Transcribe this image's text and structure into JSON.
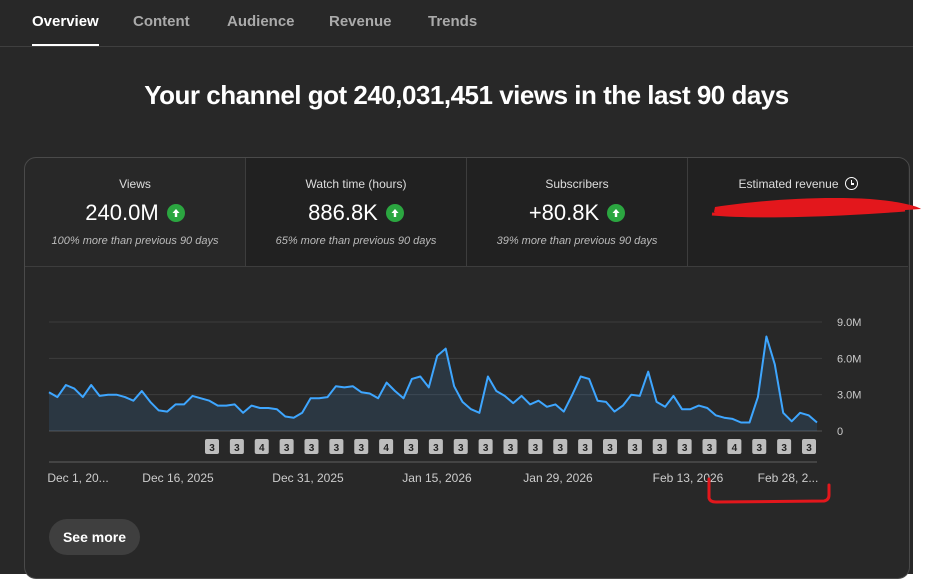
{
  "tabs": [
    {
      "label": "Overview",
      "active": true
    },
    {
      "label": "Content",
      "active": false
    },
    {
      "label": "Audience",
      "active": false
    },
    {
      "label": "Revenue",
      "active": false
    },
    {
      "label": "Trends",
      "active": false
    }
  ],
  "headline": "Your channel got 240,031,451 views in the last 90 days",
  "metrics": [
    {
      "label": "Views",
      "value": "240.0M",
      "note": "100% more than previous 90 days",
      "trend": "up"
    },
    {
      "label": "Watch time (hours)",
      "value": "886.8K",
      "note": "65% more than previous 90 days",
      "trend": "up"
    },
    {
      "label": "Subscribers",
      "value": "+80.8K",
      "note": "39% more than previous 90 days",
      "trend": "up"
    },
    {
      "label": "Estimated revenue",
      "icon": "clock-icon",
      "value_redacted": true
    }
  ],
  "colors": {
    "line": "#3ea6ff",
    "up_badge": "#2ba640",
    "redaction": "#e3171c"
  },
  "chart_data": {
    "type": "area",
    "y_ticks": [
      "9.0M",
      "6.0M",
      "3.0M",
      "0"
    ],
    "ylim": [
      0,
      9000000
    ],
    "grid": true,
    "x_ticks": [
      "Dec 1, 20...",
      "Dec 16, 2025",
      "Dec 31, 2025",
      "Jan 15, 2026",
      "Jan 29, 2026",
      "Feb 13, 2026",
      "Feb 28, 2..."
    ],
    "content_markers": [
      "3",
      "3",
      "4",
      "3",
      "3",
      "3",
      "3",
      "4",
      "3",
      "3",
      "3",
      "3",
      "3",
      "3",
      "3",
      "3",
      "3",
      "3",
      "3",
      "3",
      "3",
      "4",
      "3",
      "3",
      "3"
    ],
    "series": [
      {
        "values": [
          3.2,
          2.8,
          3.8,
          3.5,
          2.8,
          3.8,
          2.9,
          3.0,
          3.0,
          2.8,
          2.5,
          3.3,
          2.4,
          1.7,
          1.6,
          2.2,
          2.2,
          2.9,
          2.7,
          2.5,
          2.1,
          2.1,
          2.2,
          1.5,
          2.1,
          1.9,
          1.9,
          1.8,
          1.2,
          1.1,
          1.5,
          2.7,
          2.7,
          2.8,
          3.7,
          3.6,
          3.7,
          3.2,
          3.1,
          2.7,
          4.0,
          3.3,
          2.7,
          4.3,
          4.5,
          3.6,
          6.2,
          6.8,
          3.7,
          2.4,
          1.8,
          1.5,
          4.5,
          3.3,
          2.9,
          2.3,
          2.9,
          2.2,
          2.5,
          2.0,
          2.2,
          1.6,
          3.0,
          4.5,
          4.3,
          2.5,
          2.4,
          1.6,
          2.1,
          3.0,
          2.9,
          4.9,
          2.4,
          2.0,
          2.9,
          1.8,
          1.8,
          2.1,
          1.9,
          1.3,
          1.1,
          1.0,
          0.7,
          0.7,
          2.8,
          7.8,
          5.5,
          1.5,
          0.8,
          1.5,
          1.3,
          0.7
        ]
      }
    ]
  },
  "see_more": "See more"
}
